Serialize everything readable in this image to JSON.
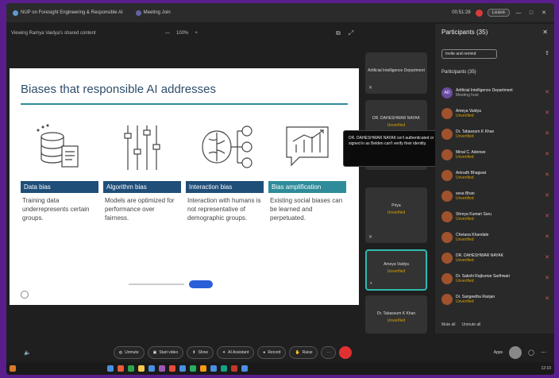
{
  "titlebar": {
    "tab1": "NUP on Foresight Engineering & Responsible AI",
    "tab2": "Meeting Join",
    "time": "00:51:28",
    "leave": "Leave",
    "winbtns": [
      "—",
      "□",
      "✕"
    ]
  },
  "subbar": {
    "title": "Viewing Ramya Vaidya's shared content",
    "zoom_minus": "—",
    "zoom_value": "100%",
    "zoom_plus": "+"
  },
  "slide": {
    "title": "Biases that responsible AI addresses",
    "columns": [
      {
        "header": "Data bias",
        "text": "Training data underrepresents certain groups."
      },
      {
        "header": "Algorithm bias",
        "text": "Models are optimized for performance over fairness."
      },
      {
        "header": "Interaction bias",
        "text": "Interaction with humans is not representative of demographic groups."
      },
      {
        "header": "Bias amplification",
        "text": "Existing social biases can be learned and perpetuated."
      }
    ]
  },
  "tiles": [
    {
      "name": "Artificial Intelligence Department",
      "status": ""
    },
    {
      "name": "DR. DAHESHWAR NAYAK",
      "status": "Unverified"
    },
    {
      "name": "Priya",
      "status": "Unverified"
    },
    {
      "name": "Ameya Vaidya",
      "status": "Unverified"
    },
    {
      "name": "Dr. Tabassum K Khan",
      "status": "Unverified"
    }
  ],
  "tooltip": "DR. DAHESHWAR NAYAK isn't authenticated or signed in as Belden can't verify their identity.",
  "panel": {
    "title": "Participants (35)",
    "invite": "Invite and remind",
    "section": "Participants (35)",
    "participants": [
      {
        "initials": "AD",
        "name": "Artificial Intelligence Department",
        "status": "Meeting host"
      },
      {
        "initials": "",
        "name": "Ameya Vaidya",
        "status": "Unverified"
      },
      {
        "initials": "",
        "name": "Dr. Tabassum K Khan",
        "status": "Unverified"
      },
      {
        "initials": "",
        "name": "Minal C. Adenwe",
        "status": "Unverified"
      },
      {
        "initials": "",
        "name": "Anirudh Bhagwat",
        "status": "Unverified"
      },
      {
        "initials": "",
        "name": "sesa Bhan",
        "status": "Unverified"
      },
      {
        "initials": "",
        "name": "Shreya Kumari Saru",
        "status": "Unverified"
      },
      {
        "initials": "",
        "name": "Chetana Khandale",
        "status": "Unverified"
      },
      {
        "initials": "",
        "name": "DR. DAHESHWAR NAYAK",
        "status": "Unverified"
      },
      {
        "initials": "",
        "name": "Dr. Sakshi Rajkumar Sarthwari",
        "status": "Unverified"
      },
      {
        "initials": "",
        "name": "Dr. Sangeetha Ranjan",
        "status": "Unverified"
      }
    ],
    "footer": [
      "Mute all",
      "Unmute all"
    ]
  },
  "controls": {
    "buttons": [
      "Unmute",
      "Start video",
      "Show",
      "AI Assistant",
      "Record",
      "Raise"
    ],
    "apps": "Apps"
  },
  "taskbar": {
    "clock": "12:10"
  }
}
